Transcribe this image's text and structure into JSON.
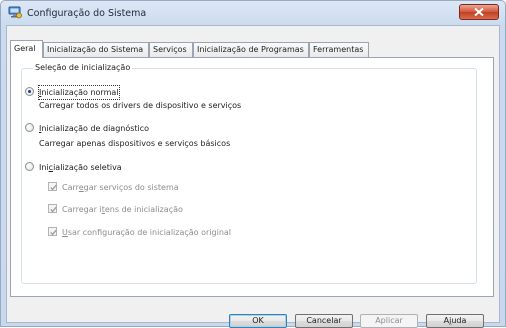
{
  "window": {
    "title": "Configuração do Sistema",
    "accent_color": "#c9d9ec",
    "close_icon": "close-icon"
  },
  "tabs": [
    {
      "label": "Geral",
      "active": true
    },
    {
      "label": "Inicialização do Sistema",
      "active": false
    },
    {
      "label": "Serviços",
      "active": false
    },
    {
      "label": "Inicialização de Programas",
      "active": false
    },
    {
      "label": "Ferramentas",
      "active": false
    }
  ],
  "startup_selection": {
    "legend": "Seleção de inicialização",
    "normal": {
      "label_pre": "",
      "label_key": "I",
      "label_post": "nicialização normal",
      "description": "Carregar todos os drivers de dispositivo e serviços",
      "checked": true
    },
    "diagnostic": {
      "label_pre": "",
      "label_key": "I",
      "label_post": "nicialização de diagnóstico",
      "description": "Carregar apenas dispositivos e serviços básicos",
      "checked": false
    },
    "selective": {
      "label_pre": "Ini",
      "label_key": "c",
      "label_post": "ialização seletiva",
      "checked": false,
      "options": [
        {
          "pre": "Carr",
          "key": "e",
          "post": "gar serviços do sistema",
          "checked": true,
          "enabled": false
        },
        {
          "pre": "Carregar i",
          "key": "t",
          "post": "ens de inicialização",
          "checked": true,
          "enabled": false
        },
        {
          "pre": "",
          "key": "U",
          "post": "sar configuração de inicialização original",
          "checked": true,
          "enabled": false
        }
      ]
    }
  },
  "buttons": {
    "ok": "OK",
    "cancel": "Cancelar",
    "apply": "Aplicar",
    "help_pre": "A",
    "help_key": "j",
    "help_post": "uda"
  }
}
